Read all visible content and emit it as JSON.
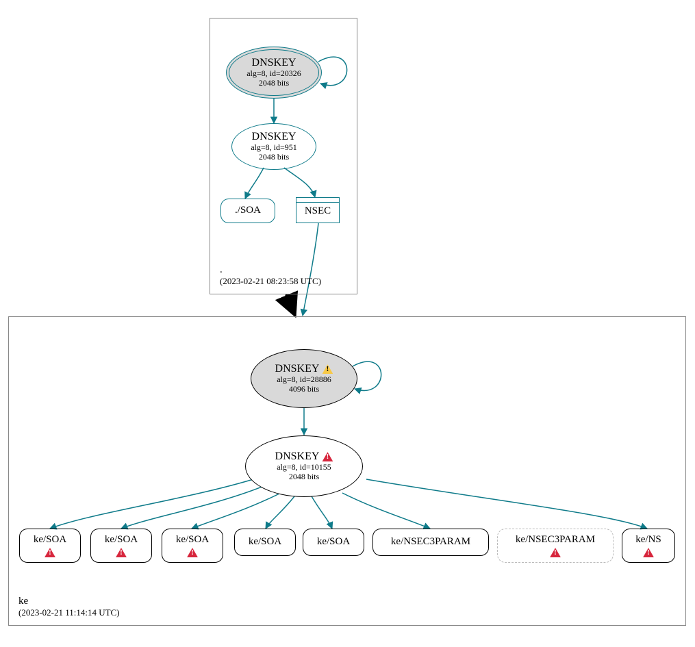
{
  "zones": {
    "root": {
      "name": ".",
      "timestamp": "(2023-02-21 08:23:58 UTC)"
    },
    "ke": {
      "name": "ke",
      "timestamp": "(2023-02-21 11:14:14 UTC)"
    }
  },
  "nodes": {
    "root_ksk": {
      "title": "DNSKEY",
      "line1": "alg=8, id=20326",
      "line2": "2048 bits"
    },
    "root_zsk": {
      "title": "DNSKEY",
      "line1": "alg=8, id=951",
      "line2": "2048 bits"
    },
    "root_soa": {
      "label": "./SOA"
    },
    "root_nsec": {
      "label": "NSEC"
    },
    "ke_ksk": {
      "title": "DNSKEY",
      "line1": "alg=8, id=28886",
      "line2": "4096 bits"
    },
    "ke_zsk": {
      "title": "DNSKEY",
      "line1": "alg=8, id=10155",
      "line2": "2048 bits"
    },
    "leaf1": {
      "label": "ke/SOA"
    },
    "leaf2": {
      "label": "ke/SOA"
    },
    "leaf3": {
      "label": "ke/SOA"
    },
    "leaf4": {
      "label": "ke/SOA"
    },
    "leaf5": {
      "label": "ke/SOA"
    },
    "leaf6": {
      "label": "ke/NSEC3PARAM"
    },
    "leaf7": {
      "label": "ke/NSEC3PARAM"
    },
    "leaf8": {
      "label": "ke/NS"
    }
  },
  "colors": {
    "edge": "#0f7b8a"
  }
}
